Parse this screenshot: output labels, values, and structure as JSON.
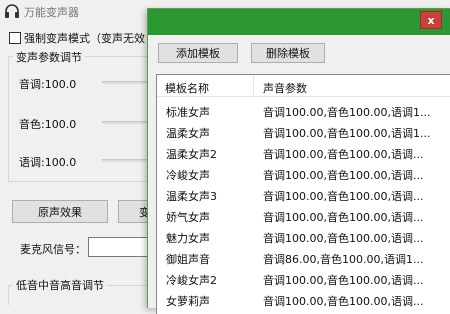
{
  "app": {
    "title": "万能变声器",
    "force_mode_label": "强制变声模式（变声无效",
    "params_group_title": "变声参数调节",
    "params": [
      {
        "label": "音调:100.0",
        "value": 100.0
      },
      {
        "label": "音色:100.0",
        "value": 100.0
      },
      {
        "label": "语调:100.0",
        "value": 100.0
      }
    ],
    "original_button": "原声效果",
    "stub_button": "变",
    "mic_label": "麦克风信号：",
    "eq_group_title": "低音中音高音调节"
  },
  "dialog": {
    "close_label": "x",
    "add_button": "添加模板",
    "delete_button": "删除模板",
    "columns": [
      "模板名称",
      "声音参数"
    ],
    "rows": [
      {
        "name": "标准女声",
        "params": "音调100.00,音色100.00,语调1..."
      },
      {
        "name": "温柔女声",
        "params": "音调100.00,音色100.00,语调1..."
      },
      {
        "name": "温柔女声2",
        "params": "音调100.00,音色100.00,语调..."
      },
      {
        "name": "冷峻女声",
        "params": "音调100.00,音色100.00,语调..."
      },
      {
        "name": "温柔女声3",
        "params": "音调100.00,音色100.00,语调..."
      },
      {
        "name": "娇气女声",
        "params": "音调100.00,音色100.00,语调..."
      },
      {
        "name": "魅力女声",
        "params": "音调100.00,音色100.00,语调..."
      },
      {
        "name": "御姐声音",
        "params": "音调86.00,音色100.00,语调1..."
      },
      {
        "name": "冷峻女声2",
        "params": "音调100.00,音色100.00,语调..."
      },
      {
        "name": "女萝莉声",
        "params": "音调100.00,音色100.00,语调..."
      }
    ]
  },
  "colors": {
    "dialog_titlebar": "#2b9834",
    "close_button": "#c8413a",
    "window_bg": "#f0f0f0",
    "button_bg": "#e1e1e1",
    "list_bg": "#ffffff"
  },
  "icons": {
    "app_icon": "headphones-icon",
    "close_icon": "close-icon"
  }
}
